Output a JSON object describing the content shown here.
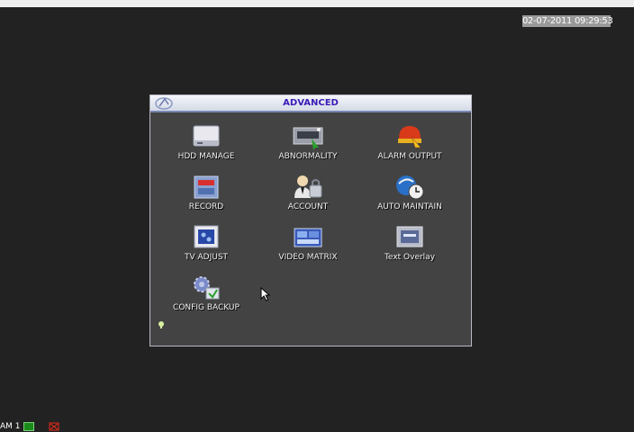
{
  "datetime": "02-07-2011 09:29:53",
  "window": {
    "title": "ADVANCED"
  },
  "menu": [
    {
      "label": "HDD MANAGE",
      "icon": "hdd-icon"
    },
    {
      "label": "ABNORMALITY",
      "icon": "abnormality-icon"
    },
    {
      "label": "ALARM OUTPUT",
      "icon": "alarm-output-icon"
    },
    {
      "label": "RECORD",
      "icon": "record-icon"
    },
    {
      "label": "ACCOUNT",
      "icon": "account-icon"
    },
    {
      "label": "AUTO MAINTAIN",
      "icon": "auto-maintain-icon"
    },
    {
      "label": "TV ADJUST",
      "icon": "tv-adjust-icon"
    },
    {
      "label": "VIDEO MATRIX",
      "icon": "video-matrix-icon"
    },
    {
      "label": "Text Overlay",
      "icon": "text-overlay-icon"
    },
    {
      "label": "CONFIG BACKUP",
      "icon": "config-backup-icon"
    }
  ],
  "status_bar": {
    "channel": "AM 1"
  },
  "colors": {
    "background": "#222222",
    "panel": "#434343",
    "title_text": "#3a1bb8",
    "record_green": "#1a8a1a",
    "alarm_red": "#cc2a1a"
  }
}
